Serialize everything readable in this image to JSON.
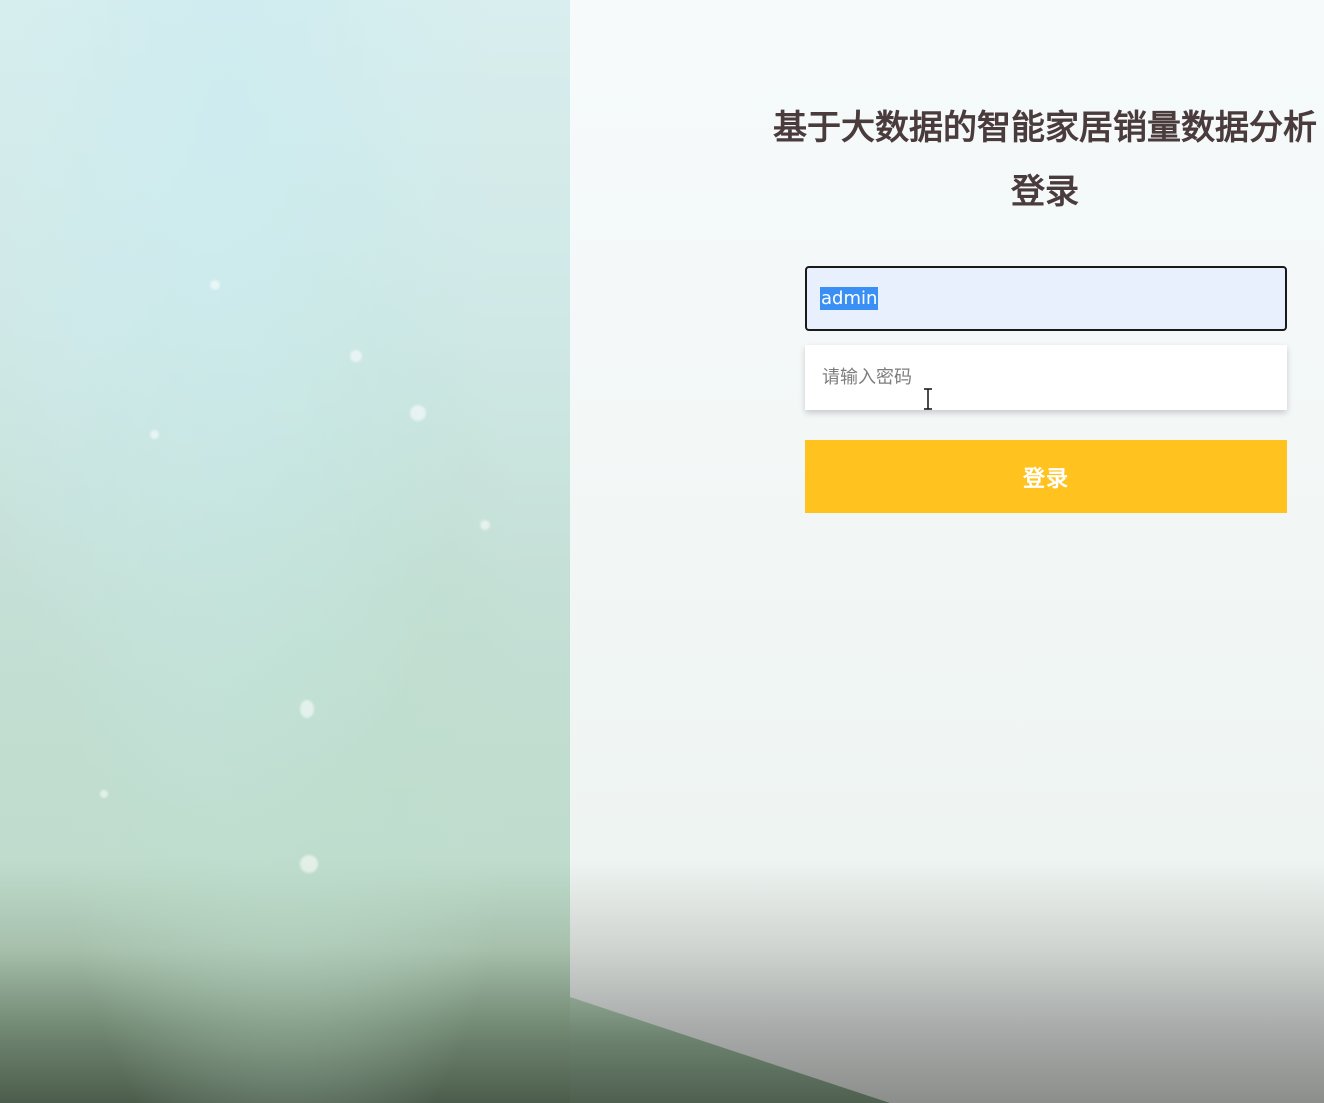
{
  "login": {
    "title": "基于大数据的智能家居销量数据分析登录",
    "username_value": "admin",
    "password_placeholder": "请输入密码",
    "submit_label": "登录"
  },
  "colors": {
    "button": "#ffc21e",
    "title": "#4a3b3c",
    "username_bg": "#e8f0fe",
    "selection": "#3a8ff5"
  }
}
